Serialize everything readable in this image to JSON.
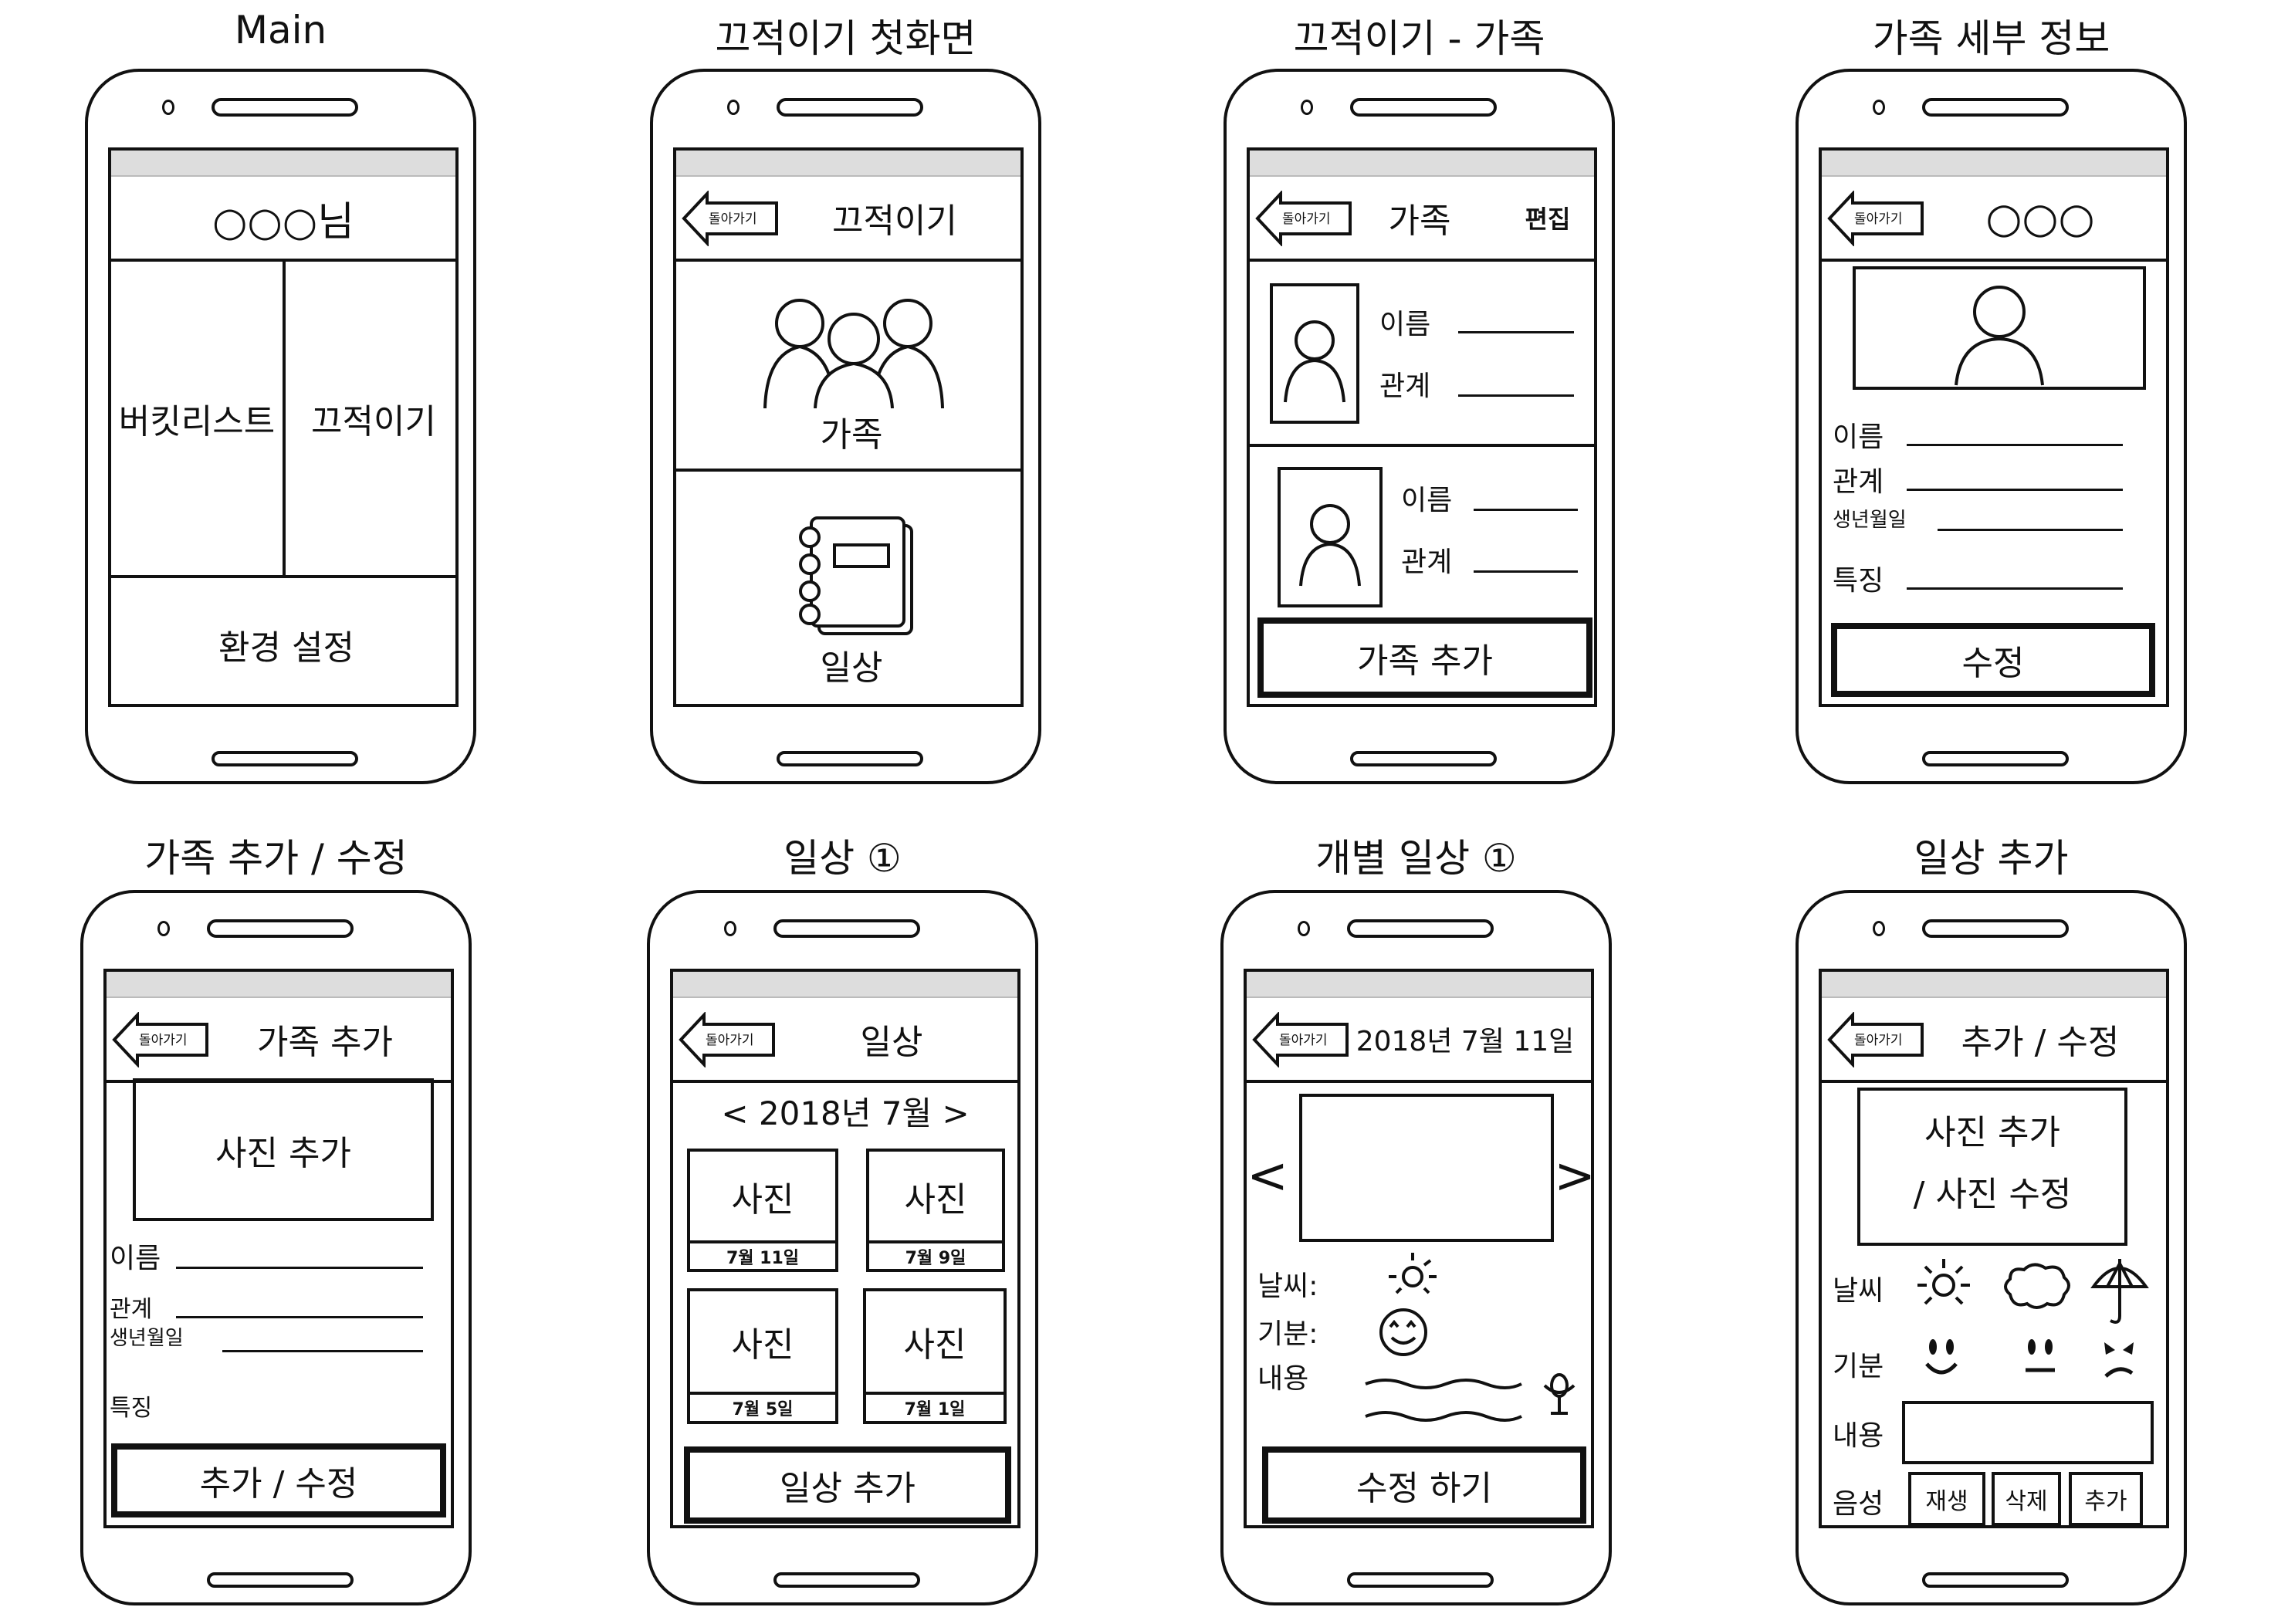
{
  "titles": {
    "main": "Main",
    "scribble_home": "끄적이기 첫화면",
    "scribble_family": "끄적이기 - 가족",
    "family_detail": "가족 세부 정보",
    "family_add_edit": "가족 추가 / 수정",
    "daily_list": "일상 ①",
    "daily_single": "개별 일상 ①",
    "daily_add": "일상 추가"
  },
  "common": {
    "back": "돌아가기"
  },
  "main": {
    "user": "○○○님",
    "bucket_list": "버킷리스트",
    "scribble": "끄적이기",
    "settings": "환경 설정"
  },
  "scribble_home": {
    "header": "끄적이기",
    "family": "가족",
    "daily": "일상"
  },
  "scribble_family": {
    "header": "가족",
    "edit": "편집",
    "name_label": "이름",
    "relation_label": "관계",
    "add_button": "가족 추가"
  },
  "family_detail": {
    "header": "○○○",
    "fields": [
      "이름",
      "관계",
      "생년월일",
      "특징"
    ],
    "edit_button": "수정"
  },
  "family_add_edit": {
    "header": "가족 추가",
    "photo": "사진 추가",
    "fields": [
      "이름",
      "관계",
      "생년월일",
      "특징"
    ],
    "submit_button": "추가 / 수정"
  },
  "daily_list": {
    "header": "일상",
    "month_nav": "< 2018년 7월 >",
    "items": [
      {
        "photo": "사진",
        "date": "7월 11일"
      },
      {
        "photo": "사진",
        "date": "7월 9일"
      },
      {
        "photo": "사진",
        "date": "7월 5일"
      },
      {
        "photo": "사진",
        "date": "7월 1일"
      }
    ],
    "add_button": "일상 추가"
  },
  "daily_single": {
    "header": "2018년 7월 11일",
    "prev": "<",
    "next": ">",
    "weather_label": "날씨:",
    "mood_label": "기분:",
    "content_label": "내용",
    "edit_button": "수정 하기"
  },
  "daily_add": {
    "header": "추가 / 수정",
    "photo_line1": "사진 추가",
    "photo_line2": "/ 사진 수정",
    "weather_label": "날씨",
    "mood_label": "기분",
    "content_label": "내용",
    "voice_label": "음성",
    "voice_buttons": [
      "재생",
      "삭제",
      "추가"
    ]
  }
}
